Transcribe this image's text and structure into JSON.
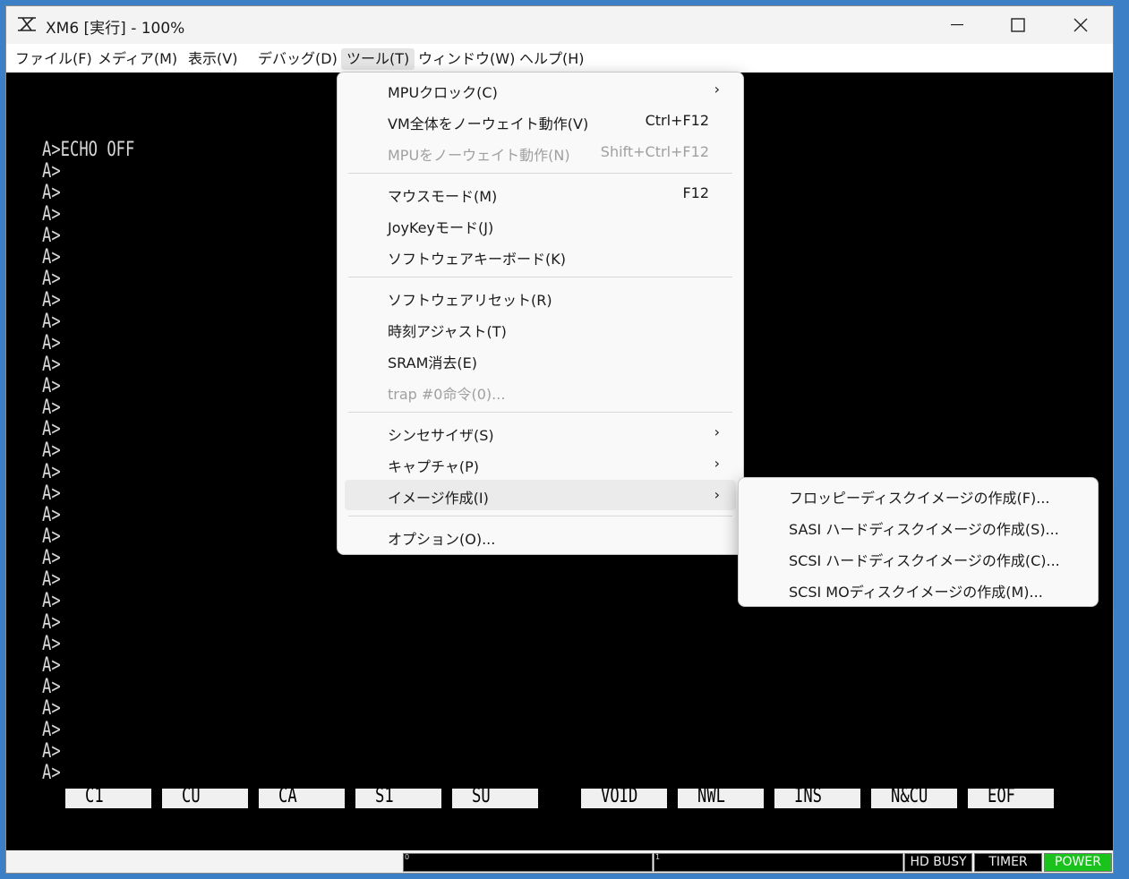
{
  "window": {
    "title": "XM6 [実行] - 100%"
  },
  "menubar": [
    "ファイル(F)",
    "メディア(M)",
    "表示(V)",
    "デバッグ(D)",
    "ツール(T)",
    "ウィンドウ(W)",
    "ヘルプ(H)"
  ],
  "screen": {
    "first_line": "A>ECHO OFF",
    "prompt": "A>",
    "function_keys": [
      "C1",
      "CU",
      "CA",
      "S1",
      "SU",
      "VOID",
      "NWL",
      "INS",
      "N&CU",
      "EOF"
    ]
  },
  "tools_menu": {
    "items": [
      {
        "label": "MPUクロック(C)",
        "submenu": true
      },
      {
        "label": "VM全体をノーウェイト動作(V)",
        "shortcut": "Ctrl+F12"
      },
      {
        "label": "MPUをノーウェイト動作(N)",
        "shortcut": "Shift+Ctrl+F12",
        "disabled": true
      },
      {
        "label": "マウスモード(M)",
        "shortcut": "F12"
      },
      {
        "label": "JoyKeyモード(J)"
      },
      {
        "label": "ソフトウェアキーボード(K)"
      },
      {
        "label": "ソフトウェアリセット(R)"
      },
      {
        "label": "時刻アジャスト(T)"
      },
      {
        "label": "SRAM消去(E)"
      },
      {
        "label": "trap #0命令(0)...",
        "disabled": true
      },
      {
        "label": "シンセサイザ(S)",
        "submenu": true
      },
      {
        "label": "キャプチャ(P)",
        "submenu": true
      },
      {
        "label": "イメージ作成(I)",
        "submenu": true,
        "highlighted": true
      },
      {
        "label": "オプション(O)..."
      }
    ]
  },
  "image_submenu": {
    "items": [
      "フロッピーディスクイメージの作成(F)...",
      "SASI ハードディスクイメージの作成(S)...",
      "SCSI ハードディスクイメージの作成(C)...",
      "SCSI MOディスクイメージの作成(M)..."
    ]
  },
  "statusbar": {
    "field0": "0",
    "field1": "1",
    "hd_busy": "HD BUSY",
    "timer": "TIMER",
    "power": "POWER"
  }
}
